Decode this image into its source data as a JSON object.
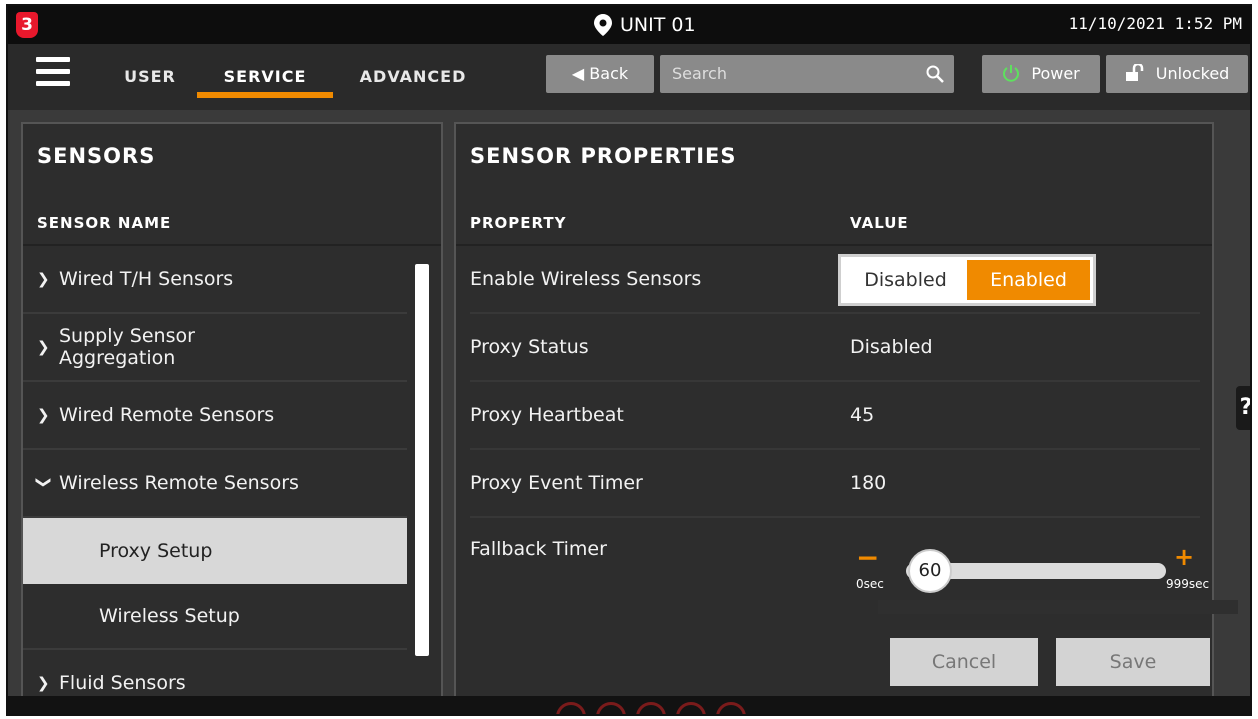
{
  "status_bar": {
    "logo_text": "3",
    "unit_label": "UNIT 01",
    "datetime": "11/10/2021 1:52 PM"
  },
  "nav": {
    "tabs": [
      {
        "label": "USER",
        "active": false
      },
      {
        "label": "SERVICE",
        "active": true
      },
      {
        "label": "ADVANCED",
        "active": false
      }
    ],
    "back_label": "Back",
    "search_placeholder": "Search",
    "power_label": "Power",
    "lock_label": "Unlocked"
  },
  "sensors_panel": {
    "title": "SENSORS",
    "column_header": "SENSOR NAME",
    "items": [
      {
        "label": "Wired T/H Sensors",
        "expanded": false
      },
      {
        "label": "Supply Sensor Aggregation",
        "line1": "Supply Sensor",
        "line2": "Aggregation",
        "expanded": false
      },
      {
        "label": "Wired Remote Sensors",
        "expanded": false
      },
      {
        "label": "Wireless Remote Sensors",
        "expanded": true
      },
      {
        "label": "Fluid Sensors",
        "expanded": false
      }
    ],
    "sub_items": [
      {
        "label": "Proxy Setup",
        "selected": true
      },
      {
        "label": "Wireless Setup",
        "selected": false
      }
    ]
  },
  "properties_panel": {
    "title": "SENSOR PROPERTIES",
    "col_property": "PROPERTY",
    "col_value": "VALUE",
    "rows": [
      {
        "name": "Enable Wireless Sensors",
        "value": ""
      },
      {
        "name": "Proxy Status",
        "value": "Disabled"
      },
      {
        "name": "Proxy Heartbeat",
        "value": "45"
      },
      {
        "name": "Proxy Event Timer",
        "value": "180"
      },
      {
        "name": "Fallback Timer",
        "value": ""
      }
    ],
    "toggle": {
      "off_label": "Disabled",
      "on_label": "Enabled",
      "selected": "Enabled"
    },
    "slider": {
      "value": "60",
      "min_label": "0sec",
      "max_label": "999sec",
      "min_symbol": "−",
      "max_symbol": "+"
    },
    "cancel_label": "Cancel",
    "save_label": "Save"
  },
  "help_label": "?",
  "colors": {
    "accent": "#f08a00",
    "brand_red": "#e8182c",
    "panel_bg": "#2d2d2d",
    "selected_row_bg": "#d8d8d8"
  }
}
